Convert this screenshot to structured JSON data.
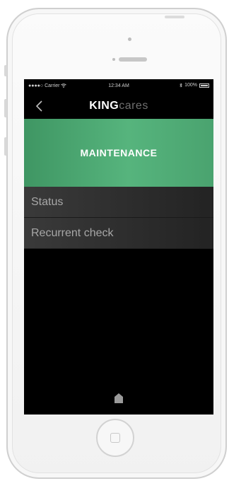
{
  "status_bar": {
    "carrier": "●●●●○ Carrier",
    "wifi": "wifi-icon",
    "time": "12:34 AM",
    "battery_text": "100%"
  },
  "nav": {
    "brand_primary": "KING",
    "brand_secondary": "cares",
    "back_icon": "chevron-left-icon"
  },
  "banner": {
    "title": "MAINTENANCE",
    "color": "#4aa56f"
  },
  "menu": {
    "items": [
      {
        "label": "Status"
      },
      {
        "label": "Recurrent check"
      }
    ]
  },
  "footer": {
    "icon": "home-icon"
  }
}
